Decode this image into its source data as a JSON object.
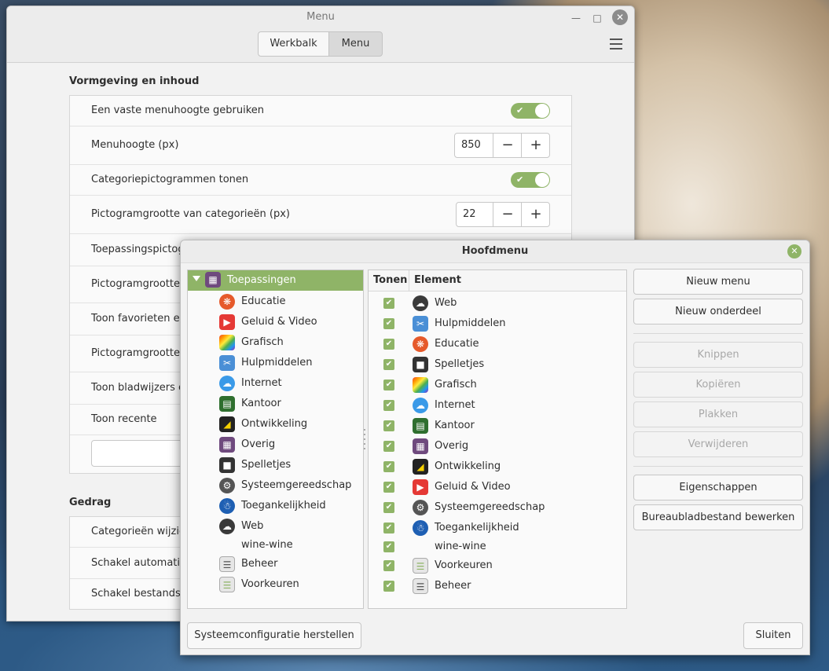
{
  "menu_window": {
    "title": "Menu",
    "tabs": [
      {
        "label": "Werkbalk"
      },
      {
        "label": "Menu"
      }
    ],
    "section1": {
      "title": "Vormgeving en inhoud",
      "rows": [
        {
          "label": "Een vaste menuhoogte gebruiken"
        },
        {
          "label": "Menuhoogte (px)",
          "value": "850"
        },
        {
          "label": "Categoriepictogrammen tonen"
        },
        {
          "label": "Pictogramgrootte van categorieën (px)",
          "value": "22"
        },
        {
          "label": "Toepassingspictog"
        },
        {
          "label": "Pictogramgrootte v"
        },
        {
          "label": "Toon favorieten en"
        },
        {
          "label": "Pictogramgrootte v"
        },
        {
          "label": "Toon bladwijzers en"
        },
        {
          "label": "Toon recente"
        }
      ]
    },
    "section2": {
      "title": "Gedrag",
      "rows": [
        {
          "label": "Categorieën wijzige"
        },
        {
          "label": "Schakel automatisc"
        },
        {
          "label": "Schakel bestandssy"
        }
      ]
    }
  },
  "dialog": {
    "title": "Hoofdmenu",
    "tree": {
      "root": "Toepassingen",
      "items": [
        {
          "label": "Educatie",
          "icon": "education-icon"
        },
        {
          "label": "Geluid & Video",
          "icon": "sound-video-icon"
        },
        {
          "label": "Grafisch",
          "icon": "graphics-icon"
        },
        {
          "label": "Hulpmiddelen",
          "icon": "accessories-icon"
        },
        {
          "label": "Internet",
          "icon": "internet-icon"
        },
        {
          "label": "Kantoor",
          "icon": "office-icon"
        },
        {
          "label": "Ontwikkeling",
          "icon": "development-icon"
        },
        {
          "label": "Overig",
          "icon": "other-icon"
        },
        {
          "label": "Spelletjes",
          "icon": "games-icon"
        },
        {
          "label": "Systeemgereedschap",
          "icon": "system-tools-icon"
        },
        {
          "label": "Toegankelijkheid",
          "icon": "accessibility-icon"
        },
        {
          "label": "Web",
          "icon": "web-icon"
        },
        {
          "label": "wine-wine",
          "icon": ""
        },
        {
          "label": "Beheer",
          "icon": "administration-icon"
        },
        {
          "label": "Voorkeuren",
          "icon": "preferences-icon"
        }
      ]
    },
    "element_list": {
      "col_show": "Tonen",
      "col_element": "Element",
      "rows": [
        {
          "label": "Web"
        },
        {
          "label": "Hulpmiddelen"
        },
        {
          "label": "Educatie"
        },
        {
          "label": "Spelletjes"
        },
        {
          "label": "Grafisch"
        },
        {
          "label": "Internet"
        },
        {
          "label": "Kantoor"
        },
        {
          "label": "Overig"
        },
        {
          "label": "Ontwikkeling"
        },
        {
          "label": "Geluid & Video"
        },
        {
          "label": "Systeemgereedschap"
        },
        {
          "label": "Toegankelijkheid"
        },
        {
          "label": "wine-wine"
        },
        {
          "label": "Voorkeuren"
        },
        {
          "label": "Beheer"
        }
      ]
    },
    "buttons": {
      "new_menu": "Nieuw menu",
      "new_item": "Nieuw onderdeel",
      "cut": "Knippen",
      "copy": "Kopiëren",
      "paste": "Plakken",
      "delete": "Verwijderen",
      "properties": "Eigenschappen",
      "edit_desktop": "Bureaubladbestand bewerken",
      "restore": "Systeemconfiguratie herstellen",
      "close": "Sluiten"
    }
  }
}
